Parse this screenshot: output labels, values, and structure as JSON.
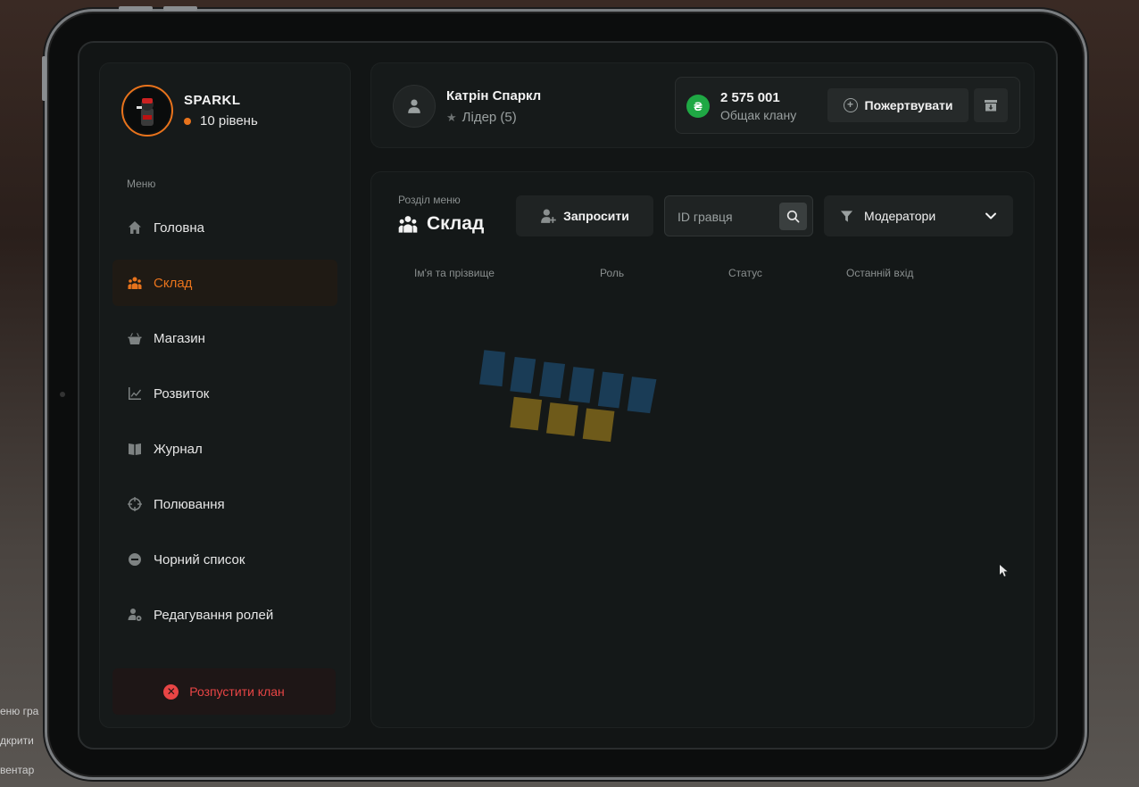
{
  "background": {
    "left_texts": [
      "еню гра",
      "дкрити",
      "вентар"
    ]
  },
  "sidebar": {
    "profile": {
      "name": "SPARKL",
      "level": "10 рівень"
    },
    "menu_label": "Меню",
    "items": [
      {
        "label": "Головна",
        "icon": "home-icon",
        "active": false
      },
      {
        "label": "Склад",
        "icon": "people-icon",
        "active": true
      },
      {
        "label": "Магазин",
        "icon": "basket-icon",
        "active": false
      },
      {
        "label": "Розвиток",
        "icon": "chart-icon",
        "active": false
      },
      {
        "label": "Журнал",
        "icon": "book-icon",
        "active": false
      },
      {
        "label": "Полювання",
        "icon": "crosshair-icon",
        "active": false
      },
      {
        "label": "Чорний список",
        "icon": "minus-circle-icon",
        "active": false
      },
      {
        "label": "Редагування ролей",
        "icon": "user-gear-icon",
        "active": false
      }
    ],
    "dissolve_label": "Розпустити клан"
  },
  "header": {
    "user_name": "Катрін Спаркл",
    "user_role": "Лідер (5)",
    "currency_symbol": "₴",
    "money_amount": "2 575 001",
    "money_label": "Общак клану",
    "donate_label": "Пожертвувати"
  },
  "content": {
    "section_label": "Розділ меню",
    "section_title": "Склад",
    "invite_label": "Запросити",
    "search_placeholder": "ID гравця",
    "filter_value": "Модератори",
    "columns": [
      "Ім'я та прізвище",
      "Роль",
      "Статус",
      "Останній вхід"
    ]
  },
  "colors": {
    "accent": "#e8731c",
    "danger": "#e84545",
    "money": "#1fa844"
  }
}
